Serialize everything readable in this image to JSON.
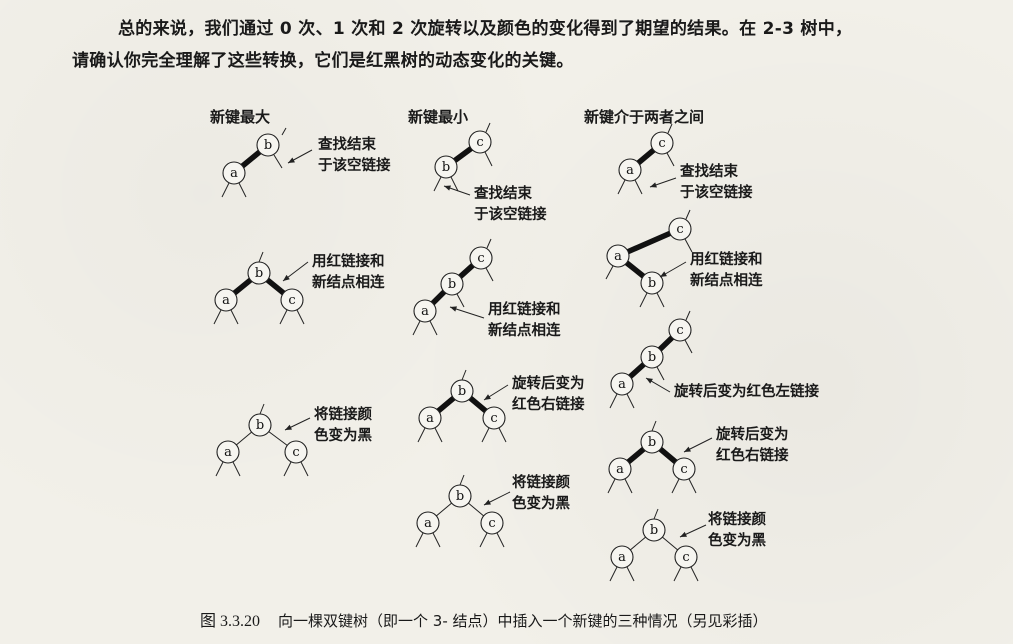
{
  "paragraph": {
    "line1": "总的来说，我们通过 0 次、1 次和 2 次旋转以及颜色的变化得到了期望的结果。在 2-3 树中，",
    "line2": "请确认你完全理解了这些转换，它们是红黑树的动态变化的关键。"
  },
  "columns": {
    "largest": "新键最大",
    "smallest": "新键最小",
    "between": "新键介于两者之间"
  },
  "annotations": {
    "search_end_1": [
      "查找结束",
      "于该空链接"
    ],
    "search_end_2": [
      "查找结束",
      "于该空链接"
    ],
    "search_end_3": [
      "查找结束",
      "于该空链接"
    ],
    "link_red_1": [
      "用红链接和",
      "新结点相连"
    ],
    "link_red_2": [
      "用红链接和",
      "新结点相连"
    ],
    "link_red_3": [
      "用红链接和",
      "新结点相连"
    ],
    "rot_right_1": [
      "旋转后变为",
      "红色右链接"
    ],
    "rot_left": "旋转后变为红色左链接",
    "rot_right_2": [
      "旋转后变为",
      "红色右链接"
    ],
    "flip_1": [
      "将链接颜",
      "色变为黑"
    ],
    "flip_2": [
      "将链接颜",
      "色变为黑"
    ],
    "flip_3": [
      "将链接颜",
      "色变为黑"
    ]
  },
  "node_labels": {
    "a": "a",
    "b": "b",
    "c": "c"
  },
  "caption": {
    "number": "图 3.3.20",
    "text": "向一棵双键树（即一个 3- 结点）中插入一个新键的三种情况（另见彩插）"
  },
  "colors": {
    "paper": "#f2f0e9",
    "ink": "#1a1a1a"
  }
}
